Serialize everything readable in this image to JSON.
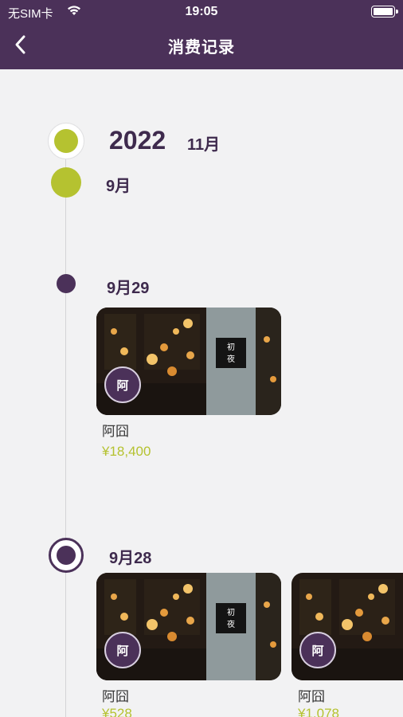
{
  "status_bar": {
    "carrier": "无SIM卡",
    "time": "19:05"
  },
  "nav": {
    "title": "消费记录",
    "back_icon": "chevron-left-icon"
  },
  "timeline": {
    "year": "2022",
    "year_month": "11月",
    "month": "9月",
    "days": [
      {
        "date": "9月29",
        "records": [
          {
            "badge": "阿",
            "shop": "阿囧",
            "amount": "¥18,400"
          }
        ]
      },
      {
        "date": "9月28",
        "records": [
          {
            "badge": "阿",
            "shop": "阿囧",
            "amount": "¥528"
          },
          {
            "badge": "阿",
            "shop": "阿囧",
            "amount": "¥1,078"
          }
        ]
      }
    ]
  },
  "colors": {
    "header": "#4b3159",
    "accent": "#b5c230",
    "background": "#f2f2f3"
  }
}
